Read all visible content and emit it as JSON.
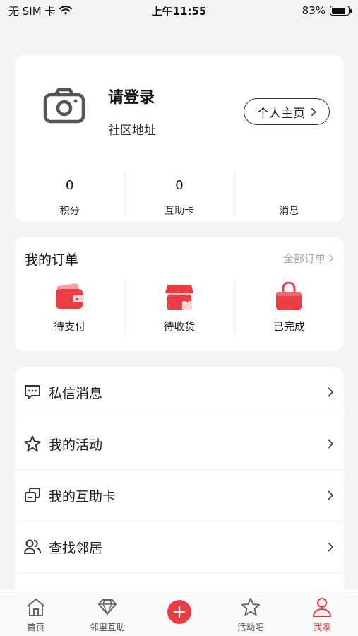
{
  "status_bar": {
    "carrier": "无 SIM 卡",
    "time": "上午11:55",
    "battery": "83%",
    "battery_level": 0.83
  },
  "profile": {
    "title": "请登录",
    "address": "社区地址",
    "profile_button": "个人主页",
    "stats": [
      {
        "value": "0",
        "label": "积分"
      },
      {
        "value": "0",
        "label": "互助卡"
      },
      {
        "value": "",
        "label": "消息"
      }
    ]
  },
  "orders": {
    "title": "我的订单",
    "all_label": "全部订单",
    "items": [
      {
        "label": "待支付",
        "icon": "wallet-icon"
      },
      {
        "label": "待收货",
        "icon": "shop-icon"
      },
      {
        "label": "已完成",
        "icon": "shopping-bag-icon"
      }
    ]
  },
  "menu": [
    {
      "label": "私信消息",
      "icon": "chat-icon"
    },
    {
      "label": "我的活动",
      "icon": "star-icon"
    },
    {
      "label": "我的互助卡",
      "icon": "card-icon"
    },
    {
      "label": "查找邻居",
      "icon": "people-icon"
    }
  ],
  "tabs": [
    {
      "label": "首页",
      "icon": "home-icon"
    },
    {
      "label": "邻里互助",
      "icon": "handshake-icon"
    },
    {
      "label": "",
      "icon": "plus-icon"
    },
    {
      "label": "活动吧",
      "icon": "star-icon"
    },
    {
      "label": "我家",
      "icon": "person-icon"
    }
  ],
  "colors": {
    "accent": "#e7383f",
    "background": "#f4f4f4"
  }
}
